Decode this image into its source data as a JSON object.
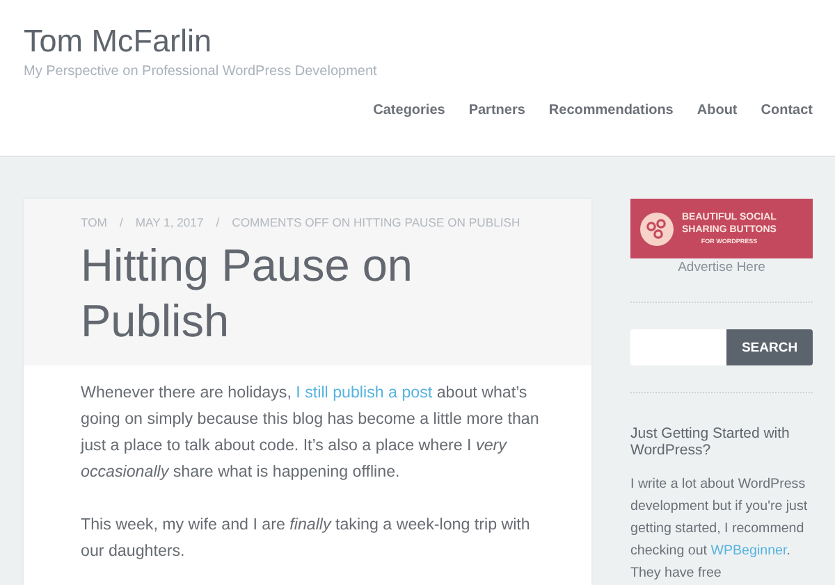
{
  "site": {
    "title": "Tom McFarlin",
    "tagline": "My Perspective on Professional WordPress Development"
  },
  "nav": [
    "Categories",
    "Partners",
    "Recommendations",
    "About",
    "Contact"
  ],
  "post": {
    "meta": [
      "TOM",
      "MAY 1, 2017",
      "COMMENTS OFF ON HITTING PAUSE ON PUBLISH"
    ],
    "separator": "/",
    "title": "Hitting Pause on Publish",
    "paragraphs": [
      [
        {
          "text": "Whenever there are holidays, ",
          "link": false
        },
        {
          "text": "I still publish a post",
          "link": true
        },
        {
          "text": " about what’s going on simply because this blog has become a little more than just a place to talk about code. It’s also a place where I *very occasionally* share what is happening offline.",
          "link": false
        }
      ],
      [
        {
          "text": "This week, my wife and I are *finally* taking a week-long trip with our daughters.",
          "link": false
        }
      ]
    ]
  },
  "sidebar": {
    "ad": {
      "lines": [
        "BEAUTIFUL SOCIAL",
        "SHARING BUTTONS",
        "FOR WORDPRESS"
      ],
      "link": "Advertise Here"
    },
    "search": {
      "button": "SEARCH"
    },
    "widget": {
      "title": "Just Getting Started with WordPress?",
      "parts": [
        {
          "text": "I write a lot about WordPress development but if you're just getting started, I recommend checking out ",
          "link": false
        },
        {
          "text": "WPBeginner",
          "link": true
        },
        {
          "text": ". They have free",
          "link": false
        }
      ]
    }
  }
}
